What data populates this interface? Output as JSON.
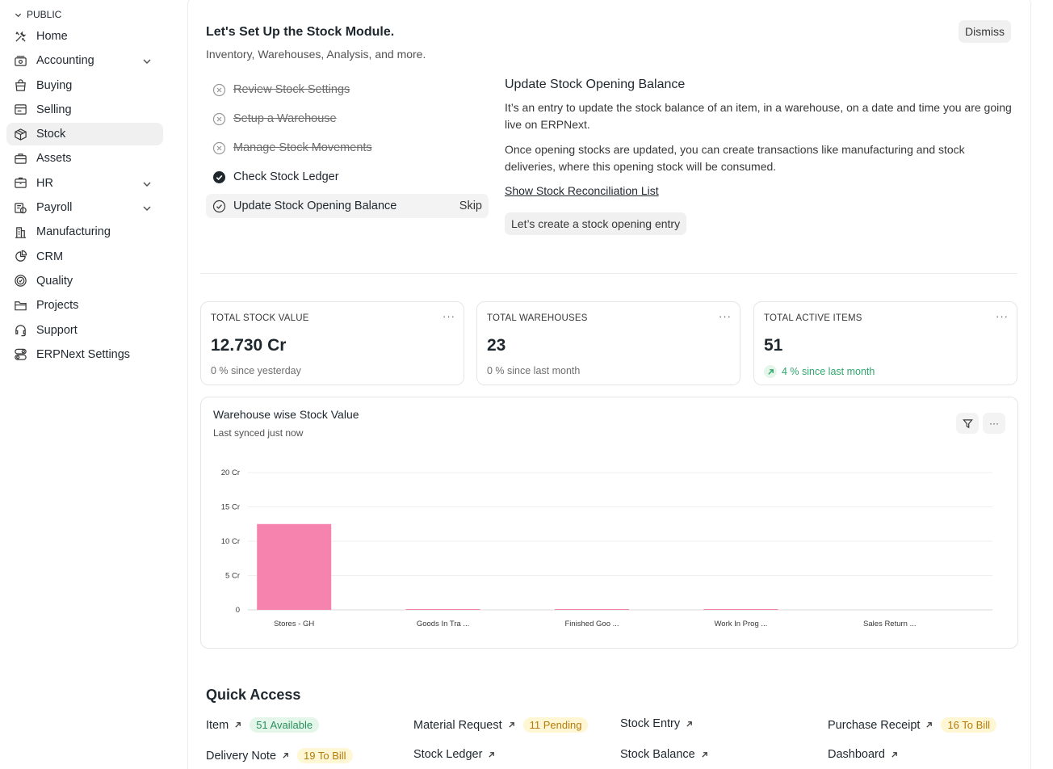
{
  "sidebar": {
    "section": "PUBLIC",
    "items": [
      {
        "label": "Home",
        "icon": "tools-icon"
      },
      {
        "label": "Accounting",
        "icon": "accounting-icon",
        "expandable": true
      },
      {
        "label": "Buying",
        "icon": "buying-icon"
      },
      {
        "label": "Selling",
        "icon": "selling-icon"
      },
      {
        "label": "Stock",
        "icon": "stock-icon",
        "active": true
      },
      {
        "label": "Assets",
        "icon": "assets-icon"
      },
      {
        "label": "HR",
        "icon": "hr-icon",
        "expandable": true
      },
      {
        "label": "Payroll",
        "icon": "payroll-icon",
        "expandable": true
      },
      {
        "label": "Manufacturing",
        "icon": "building-icon"
      },
      {
        "label": "CRM",
        "icon": "crm-icon"
      },
      {
        "label": "Quality",
        "icon": "quality-icon"
      },
      {
        "label": "Projects",
        "icon": "folder-icon"
      },
      {
        "label": "Support",
        "icon": "headset-icon"
      },
      {
        "label": "ERPNext Settings",
        "icon": "toggle-icon"
      }
    ]
  },
  "onboarding": {
    "title": "Let's Set Up the Stock Module.",
    "subtitle": "Inventory, Warehouses, Analysis, and more.",
    "dismiss": "Dismiss",
    "steps": [
      {
        "label": "Review Stock Settings",
        "state": "skipped"
      },
      {
        "label": "Setup a Warehouse",
        "state": "skipped"
      },
      {
        "label": "Manage Stock Movements",
        "state": "skipped"
      },
      {
        "label": "Check Stock Ledger",
        "state": "completed"
      },
      {
        "label": "Update Stock Opening Balance",
        "state": "active"
      }
    ],
    "skip": "Skip",
    "detail": {
      "title": "Update Stock Opening Balance",
      "p1": "It’s an entry to update the stock balance of an item, in a warehouse, on a date and time you are going live on ERPNext.",
      "p2": "Once opening stocks are updated, you can create transactions like manufacturing and stock deliveries, where this opening stock will be consumed.",
      "link": "Show Stock Reconciliation List",
      "button": "Let’s create a stock opening entry"
    }
  },
  "number_cards": [
    {
      "label": "TOTAL STOCK VALUE",
      "value": "12.730 Cr",
      "stat": "0 % since yesterday",
      "trend": "none"
    },
    {
      "label": "TOTAL WAREHOUSES",
      "value": "23",
      "stat": "0 % since last month",
      "trend": "none"
    },
    {
      "label": "TOTAL ACTIVE ITEMS",
      "value": "51",
      "stat": "4 % since last month",
      "trend": "up"
    }
  ],
  "more_label": "···",
  "chart_card": {
    "title": "Warehouse wise Stock Value",
    "subtitle": "Last synced just now"
  },
  "chart_data": {
    "type": "bar",
    "categories": [
      "Stores - GH",
      "Goods In Tra ...",
      "Finished Goo ...",
      "Work In Prog ...",
      "Sales Return ..."
    ],
    "values": [
      12.5,
      0.05,
      0.05,
      0.05,
      0.0
    ],
    "ylim": [
      0,
      20
    ],
    "yticks": [
      0,
      5,
      10,
      15,
      20
    ],
    "ytick_labels": [
      "0",
      "5 Cr",
      "10 Cr",
      "15 Cr",
      "20 Cr"
    ],
    "grid": true,
    "color": "#f683ae"
  },
  "quick_access": {
    "title": "Quick Access",
    "items": [
      {
        "label": "Item",
        "badge": "51 Available",
        "badge_color": "green"
      },
      {
        "label": "Material Request",
        "badge": "11 Pending",
        "badge_color": "yellow"
      },
      {
        "label": "Stock Entry",
        "badge": ""
      },
      {
        "label": "Purchase Receipt",
        "badge": "16 To Bill",
        "badge_color": "yellow"
      },
      {
        "label": "Delivery Note",
        "badge": "19 To Bill",
        "badge_color": "yellow"
      },
      {
        "label": "Stock Ledger",
        "badge": ""
      },
      {
        "label": "Stock Balance",
        "badge": ""
      },
      {
        "label": "Dashboard",
        "badge": ""
      }
    ]
  }
}
